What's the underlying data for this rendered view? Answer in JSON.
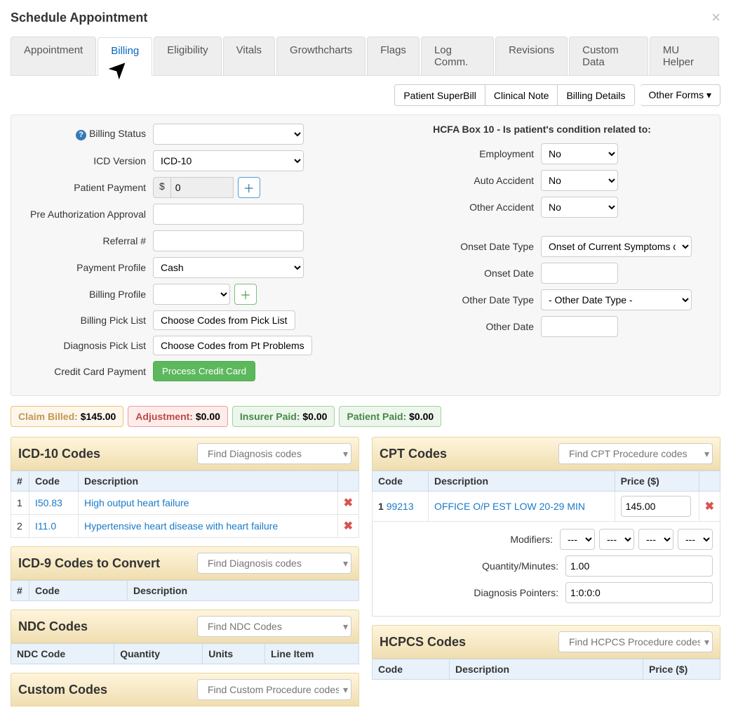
{
  "modal": {
    "title": "Schedule Appointment"
  },
  "tabs": [
    "Appointment",
    "Billing",
    "Eligibility",
    "Vitals",
    "Growthcharts",
    "Flags",
    "Log Comm.",
    "Revisions",
    "Custom Data",
    "MU Helper"
  ],
  "active_tab_index": 1,
  "action_buttons": {
    "superbill": "Patient SuperBill",
    "clinical_note": "Clinical Note",
    "billing_details": "Billing Details",
    "other_forms": "Other Forms"
  },
  "billing_form": {
    "billing_status_label": "Billing Status",
    "icd_version_label": "ICD Version",
    "icd_version_value": "ICD-10",
    "patient_payment_label": "Patient Payment",
    "patient_payment_currency": "$",
    "patient_payment_value": "0",
    "pre_auth_label": "Pre Authorization Approval",
    "referral_label": "Referral #",
    "payment_profile_label": "Payment Profile",
    "payment_profile_value": "Cash",
    "billing_profile_label": "Billing Profile",
    "billing_pick_label": "Billing Pick List",
    "billing_pick_btn": "Choose Codes from Pick List",
    "diagnosis_pick_label": "Diagnosis Pick List",
    "diagnosis_pick_btn": "Choose Codes from Pt Problems",
    "cc_payment_label": "Credit Card Payment",
    "cc_payment_btn": "Process Credit Card"
  },
  "hcfa": {
    "heading": "HCFA Box 10 - Is patient's condition related to:",
    "employment_label": "Employment",
    "employment_value": "No",
    "auto_label": "Auto Accident",
    "auto_value": "No",
    "other_label": "Other Accident",
    "other_value": "No",
    "onset_type_label": "Onset Date Type",
    "onset_type_value": "Onset of Current Symptoms o",
    "onset_date_label": "Onset Date",
    "other_date_type_label": "Other Date Type",
    "other_date_type_value": "- Other Date Type -",
    "other_date_label": "Other Date"
  },
  "badges": {
    "claim_billed_label": "Claim Billed:",
    "claim_billed_value": "$145.00",
    "adjustment_label": "Adjustment:",
    "adjustment_value": "$0.00",
    "insurer_paid_label": "Insurer Paid:",
    "insurer_paid_value": "$0.00",
    "patient_paid_label": "Patient Paid:",
    "patient_paid_value": "$0.00"
  },
  "icd10": {
    "title": "ICD-10 Codes",
    "search_placeholder": "Find Diagnosis codes",
    "cols": {
      "num": "#",
      "code": "Code",
      "desc": "Description"
    },
    "rows": [
      {
        "n": "1",
        "code": "I50.83",
        "desc": "High output heart failure"
      },
      {
        "n": "2",
        "code": "I11.0",
        "desc": "Hypertensive heart disease with heart failure"
      }
    ]
  },
  "icd9": {
    "title": "ICD-9 Codes to Convert",
    "search_placeholder": "Find Diagnosis codes",
    "cols": {
      "num": "#",
      "code": "Code",
      "desc": "Description"
    }
  },
  "ndc": {
    "title": "NDC Codes",
    "search_placeholder": "Find NDC Codes",
    "cols": {
      "code": "NDC Code",
      "qty": "Quantity",
      "units": "Units",
      "line": "Line Item"
    }
  },
  "custom": {
    "title": "Custom Codes",
    "search_placeholder": "Find Custom Procedure codes"
  },
  "cpt": {
    "title": "CPT Codes",
    "search_placeholder": "Find CPT Procedure codes",
    "cols": {
      "code": "Code",
      "desc": "Description",
      "price": "Price ($)"
    },
    "row": {
      "num": "1",
      "code": "99213",
      "desc": "OFFICE O/P EST LOW 20-29 MIN",
      "price": "145.00"
    },
    "detail": {
      "modifiers_label": "Modifiers:",
      "modifier_placeholder": "---",
      "qty_label": "Quantity/Minutes:",
      "qty_value": "1.00",
      "dp_label": "Diagnosis Pointers:",
      "dp_value": "1:0:0:0"
    }
  },
  "hcpcs": {
    "title": "HCPCS Codes",
    "search_placeholder": "Find HCPCS Procedure codes",
    "cols": {
      "code": "Code",
      "desc": "Description",
      "price": "Price ($)"
    }
  }
}
